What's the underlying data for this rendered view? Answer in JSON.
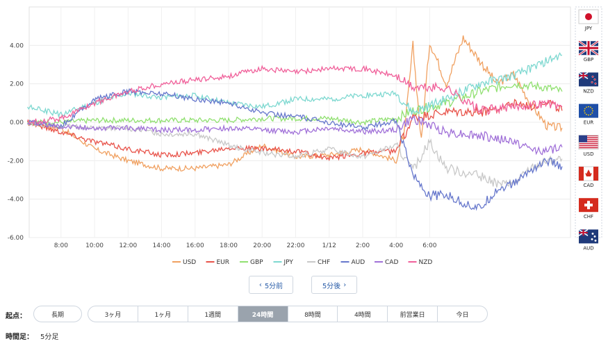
{
  "chart_data": {
    "type": "line",
    "y_ticks": [
      "4.00",
      "2.00",
      "0.00",
      "-2.00",
      "-4.00",
      "-6.00"
    ],
    "x_ticks": [
      "8:00",
      "10:00",
      "12:00",
      "14:00",
      "16:00",
      "18:00",
      "20:00",
      "22:00",
      "1/12",
      "2:00",
      "4:00",
      "6:00"
    ],
    "ylim": [
      -6,
      6
    ],
    "grid": true,
    "legend_position": "bottom",
    "series": [
      {
        "name": "USD",
        "color": "#f0a060",
        "anchors": [
          [
            0,
            0
          ],
          [
            2,
            -0.3
          ],
          [
            4,
            -1.4
          ],
          [
            6,
            -2.0
          ],
          [
            8,
            -2.4
          ],
          [
            10,
            -2.4
          ],
          [
            12,
            -2.2
          ],
          [
            14,
            -1.2
          ],
          [
            16,
            -1.8
          ],
          [
            18,
            -1.7
          ],
          [
            20,
            -1.4
          ],
          [
            22,
            -2.0
          ],
          [
            22.5,
            -0.5
          ],
          [
            23,
            4.0
          ],
          [
            23.5,
            -1.0
          ],
          [
            24,
            4.2
          ],
          [
            25,
            2.0
          ],
          [
            26,
            4.4
          ],
          [
            28,
            2.0
          ],
          [
            29,
            2.5
          ],
          [
            30,
            1.0
          ],
          [
            31,
            -0.2
          ],
          [
            31.9,
            -0.3
          ]
        ]
      },
      {
        "name": "EUR",
        "color": "#e8534a",
        "anchors": [
          [
            0,
            0
          ],
          [
            2,
            -0.5
          ],
          [
            4,
            -1.0
          ],
          [
            6,
            -1.4
          ],
          [
            8,
            -1.7
          ],
          [
            10,
            -1.6
          ],
          [
            12,
            -1.3
          ],
          [
            14,
            -1.4
          ],
          [
            16,
            -1.5
          ],
          [
            18,
            -1.9
          ],
          [
            20,
            -1.6
          ],
          [
            22,
            -1.5
          ],
          [
            23,
            0.2
          ],
          [
            25,
            0.5
          ],
          [
            27,
            0.5
          ],
          [
            29,
            1.0
          ],
          [
            30,
            0.8
          ],
          [
            31,
            1.1
          ],
          [
            31.9,
            0.6
          ]
        ]
      },
      {
        "name": "GBP",
        "color": "#90e070",
        "anchors": [
          [
            0,
            0
          ],
          [
            2,
            0.0
          ],
          [
            4,
            0.1
          ],
          [
            6,
            0.1
          ],
          [
            8,
            0.1
          ],
          [
            10,
            0.1
          ],
          [
            12,
            0.1
          ],
          [
            14,
            0.2
          ],
          [
            16,
            0.2
          ],
          [
            18,
            0.2
          ],
          [
            20,
            0.0
          ],
          [
            22,
            0.2
          ],
          [
            23,
            0.6
          ],
          [
            25,
            1.0
          ],
          [
            27,
            1.6
          ],
          [
            29,
            2.0
          ],
          [
            31,
            1.8
          ],
          [
            31.9,
            1.6
          ]
        ]
      },
      {
        "name": "JPY",
        "color": "#7dd8d0",
        "anchors": [
          [
            0,
            0.8
          ],
          [
            2,
            0.4
          ],
          [
            4,
            1.0
          ],
          [
            6,
            1.5
          ],
          [
            8,
            1.3
          ],
          [
            10,
            1.4
          ],
          [
            12,
            1.0
          ],
          [
            14,
            0.8
          ],
          [
            16,
            1.2
          ],
          [
            18,
            1.2
          ],
          [
            20,
            1.4
          ],
          [
            22,
            1.5
          ],
          [
            23,
            0.5
          ],
          [
            25,
            1.2
          ],
          [
            27,
            2.0
          ],
          [
            29,
            2.4
          ],
          [
            31,
            3.2
          ],
          [
            31.9,
            3.5
          ]
        ]
      },
      {
        "name": "CHF",
        "color": "#c8c8c8",
        "anchors": [
          [
            0,
            0
          ],
          [
            2,
            -0.2
          ],
          [
            4,
            -0.3
          ],
          [
            6,
            -0.3
          ],
          [
            8,
            -0.6
          ],
          [
            10,
            -0.6
          ],
          [
            12,
            -1.2
          ],
          [
            14,
            -1.6
          ],
          [
            16,
            -1.8
          ],
          [
            18,
            -1.4
          ],
          [
            20,
            -1.8
          ],
          [
            22,
            -1.2
          ],
          [
            23,
            -2.5
          ],
          [
            24,
            -1.0
          ],
          [
            25,
            -2.4
          ],
          [
            26,
            -2.6
          ],
          [
            27,
            -2.8
          ],
          [
            28,
            -3.2
          ],
          [
            29,
            -3.2
          ],
          [
            30,
            -2.4
          ],
          [
            31,
            -2.0
          ],
          [
            31.9,
            -1.9
          ]
        ]
      },
      {
        "name": "AUD",
        "color": "#6677cc",
        "anchors": [
          [
            0,
            0
          ],
          [
            2,
            -0.2
          ],
          [
            4,
            1.2
          ],
          [
            6,
            1.6
          ],
          [
            8,
            1.5
          ],
          [
            10,
            1.2
          ],
          [
            12,
            1.0
          ],
          [
            14,
            0.5
          ],
          [
            16,
            0.3
          ],
          [
            18,
            0.0
          ],
          [
            20,
            -0.3
          ],
          [
            22,
            0.1
          ],
          [
            23,
            -2.8
          ],
          [
            24,
            -3.8
          ],
          [
            25,
            -3.8
          ],
          [
            26,
            -4.2
          ],
          [
            27,
            -4.5
          ],
          [
            28,
            -3.5
          ],
          [
            29,
            -3.2
          ],
          [
            30,
            -2.5
          ],
          [
            31,
            -2.0
          ],
          [
            31.9,
            -2.3
          ]
        ]
      },
      {
        "name": "CAD",
        "color": "#a070d8",
        "anchors": [
          [
            0,
            0
          ],
          [
            2,
            -0.2
          ],
          [
            4,
            -0.3
          ],
          [
            6,
            -0.3
          ],
          [
            8,
            -0.4
          ],
          [
            10,
            -0.4
          ],
          [
            12,
            -0.3
          ],
          [
            14,
            -0.4
          ],
          [
            16,
            -0.5
          ],
          [
            18,
            -0.3
          ],
          [
            20,
            -0.5
          ],
          [
            22,
            -0.4
          ],
          [
            23,
            0.2
          ],
          [
            25,
            -0.5
          ],
          [
            27,
            -0.7
          ],
          [
            29,
            -1.0
          ],
          [
            30,
            -1.4
          ],
          [
            31,
            -1.5
          ],
          [
            31.9,
            -1.3
          ]
        ]
      },
      {
        "name": "NZD",
        "color": "#f0609a",
        "anchors": [
          [
            0,
            0
          ],
          [
            2,
            0.2
          ],
          [
            4,
            1.0
          ],
          [
            6,
            1.6
          ],
          [
            8,
            2.0
          ],
          [
            10,
            2.2
          ],
          [
            12,
            2.4
          ],
          [
            14,
            2.8
          ],
          [
            16,
            2.6
          ],
          [
            18,
            2.8
          ],
          [
            20,
            2.8
          ],
          [
            22,
            2.4
          ],
          [
            23,
            1.8
          ],
          [
            25,
            1.8
          ],
          [
            27,
            0.6
          ],
          [
            29,
            0.8
          ],
          [
            31,
            1.0
          ],
          [
            31.9,
            0.8
          ]
        ]
      }
    ]
  },
  "flags": [
    {
      "code": "JPY"
    },
    {
      "code": "GBP"
    },
    {
      "code": "NZD"
    },
    {
      "code": "EUR"
    },
    {
      "code": "USD"
    },
    {
      "code": "CAD"
    },
    {
      "code": "CHF"
    },
    {
      "code": "AUD"
    }
  ],
  "nav": {
    "prev_label": "5分前",
    "next_label": "5分後",
    "prev_icon": "chevron-left-icon",
    "next_icon": "chevron-right-icon"
  },
  "range": {
    "label": "起点：",
    "long": "長期",
    "options": [
      "3ヶ月",
      "1ヶ月",
      "1週間",
      "24時間",
      "8時間",
      "4時間",
      "前営業日",
      "今日"
    ],
    "active": "24時間"
  },
  "interval": {
    "label": "時間足：",
    "value": "5分足"
  }
}
